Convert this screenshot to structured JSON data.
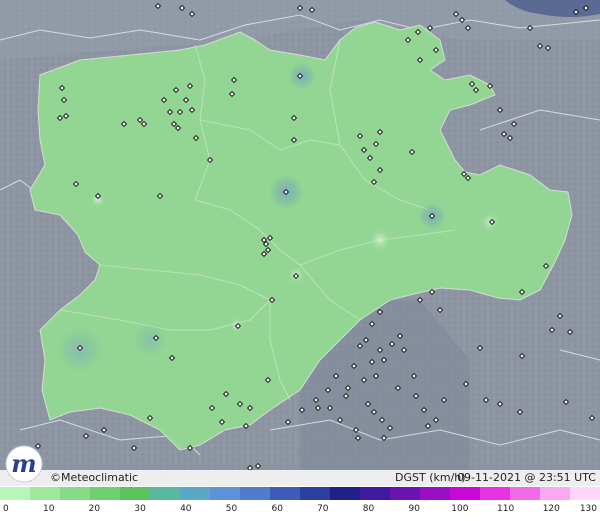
{
  "brand": {
    "name": "©Meteoclimatic",
    "logo_letter": "m",
    "logo_color": "#2d3e8c"
  },
  "map_info": {
    "variable_label": "DGST (km/h)",
    "timestamp": "09-11-2021 @ 23:51 UTC"
  },
  "legend": {
    "colors": [
      "#b8f5b8",
      "#9ee89e",
      "#86dc86",
      "#6ed06e",
      "#5cc25c",
      "#57b99e",
      "#5aa7c6",
      "#5d92d8",
      "#4f7ccc",
      "#3c5cb8",
      "#2a3fa0",
      "#20208a",
      "#3d1aa0",
      "#6a14b4",
      "#9a0ec8",
      "#c808d8",
      "#e632e0",
      "#f26ae8",
      "#fba8f2",
      "#ffd6fa"
    ],
    "tick_labels": [
      "0",
      "10",
      "20",
      "30",
      "40",
      "50",
      "60",
      "70",
      "80",
      "90",
      "100",
      "110",
      "120",
      "130"
    ]
  },
  "colors": {
    "background": "#8e96a4",
    "region_fill": "#93d693",
    "region_border": "#b9c6bb",
    "station_marker": "#1b1b1b"
  }
}
